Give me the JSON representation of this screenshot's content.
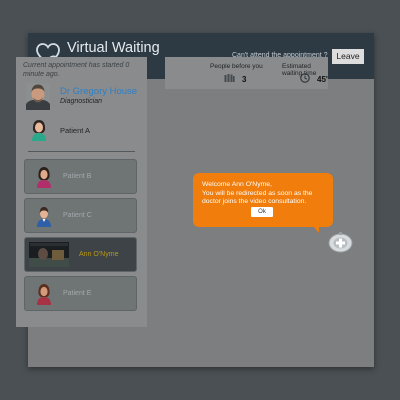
{
  "header": {
    "title": "Virtual Waiting Room",
    "cant_attend": "Can't attend the appointment ?",
    "leave_label": "Leave"
  },
  "appointment": {
    "notice": "Current appointment has started 0 minute ago.",
    "doctor_name": "Dr Gregory House",
    "doctor_role": "Diagnostician",
    "current_patient": "Patient A"
  },
  "queue": [
    {
      "label": "Patient B"
    },
    {
      "label": "Patient C"
    },
    {
      "label": "Ann O'Nyme"
    },
    {
      "label": "Patient E"
    }
  ],
  "stats": {
    "people_label": "People before you",
    "people_value": "3",
    "wait_label": "Estimated waiting time",
    "wait_value": "45'"
  },
  "popup": {
    "message": "Welcome Ann O'Nyme,\nYou will be redirected as soon as the doctor joins the video consultation.",
    "ok_label": "Ok"
  },
  "colors": {
    "header_bg": "#2d3a44",
    "accent_blue": "#2d80c9",
    "bubble_orange": "#f07d0c",
    "active_name": "#b89818"
  },
  "icons": [
    "heart-clock-logo-icon",
    "people-icon",
    "clock-icon",
    "assistant-bot-icon"
  ]
}
